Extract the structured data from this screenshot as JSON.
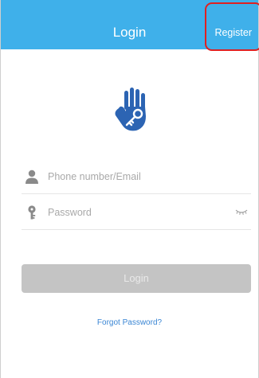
{
  "header": {
    "title": "Login",
    "register_label": "Register"
  },
  "brand": {
    "icon": "hand-key-logo-icon",
    "color": "#2c64b3"
  },
  "form": {
    "phone_email_placeholder": "Phone number/Email",
    "phone_email_value": "",
    "password_placeholder": "Password",
    "password_value": "",
    "user_icon": "user-icon",
    "key_icon": "key-icon",
    "eye_icon": "eye-closed-icon"
  },
  "actions": {
    "login_label": "Login",
    "forgot_password_label": "Forgot Password?"
  },
  "colors": {
    "header_bg": "#3fb0ea",
    "button_disabled_bg": "#c4c4c4",
    "link": "#3a86d4",
    "highlight": "#e02020"
  }
}
